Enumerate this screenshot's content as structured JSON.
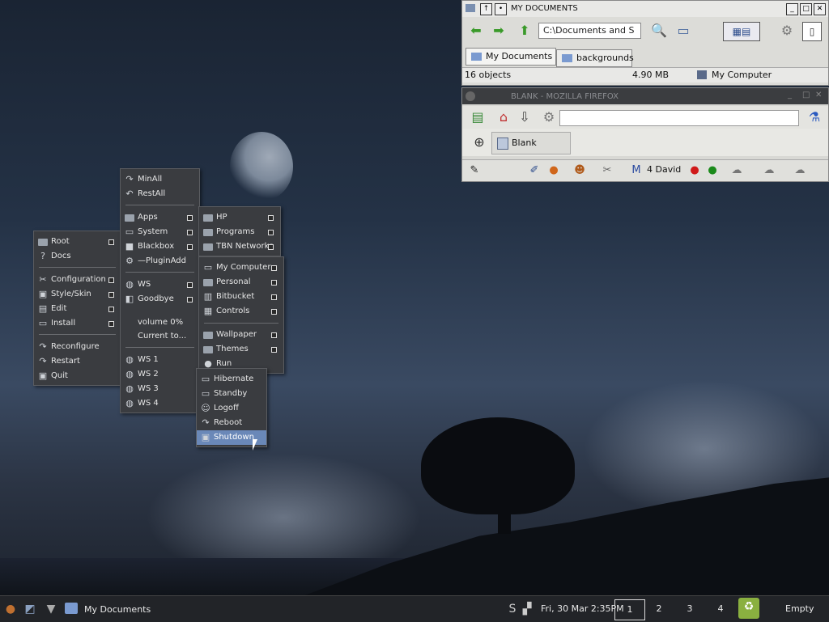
{
  "explorer": {
    "title": "MY DOCUMENTS",
    "path_value": "C:\\Documents and S",
    "tabs": [
      "My Documents",
      "backgrounds"
    ],
    "status": {
      "objects": "16 objects",
      "size": "4.90 MB",
      "location": "My Computer"
    }
  },
  "firefox": {
    "title": "BLANK - MOZILLA FIREFOX",
    "tab_label": "Blank",
    "statusbar_user": "4 David"
  },
  "menu_root": {
    "items": [
      {
        "label": "Root",
        "icon": "root-icon",
        "sub": true
      },
      {
        "label": "Docs",
        "icon": "help-icon",
        "sub": false
      },
      {
        "label": "Configuration",
        "icon": "tools-icon",
        "sub": true
      },
      {
        "label": "Style/Skin",
        "icon": "skin-icon",
        "sub": true
      },
      {
        "label": "Edit",
        "icon": "edit-icon",
        "sub": true
      },
      {
        "label": "Install",
        "icon": "install-icon",
        "sub": true
      },
      {
        "label": "Reconfigure",
        "icon": "arrow-icon",
        "sub": false
      },
      {
        "label": "Restart",
        "icon": "arrow-icon",
        "sub": false
      },
      {
        "label": "Quit",
        "icon": "quit-icon",
        "sub": false
      }
    ]
  },
  "menu_main": {
    "items": [
      {
        "label": "MinAll",
        "icon": "minall-icon",
        "sub": false
      },
      {
        "label": "RestAll",
        "icon": "restall-icon",
        "sub": false
      },
      {
        "label": "Apps",
        "icon": "folder-icon",
        "sub": true
      },
      {
        "label": "System",
        "icon": "system-icon",
        "sub": true
      },
      {
        "label": "Blackbox",
        "icon": "blackbox-icon",
        "sub": true
      },
      {
        "label": "—PluginAdd",
        "icon": "gear-icon",
        "sub": false
      },
      {
        "label": "WS",
        "icon": "ws-icon",
        "sub": true
      },
      {
        "label": "Goodbye",
        "icon": "goodbye-icon",
        "sub": true
      },
      {
        "label": "volume 0%",
        "icon": "",
        "sub": false
      },
      {
        "label": "Current to...",
        "icon": "",
        "sub": false
      },
      {
        "label": "WS 1",
        "icon": "ws-icon",
        "sub": false
      },
      {
        "label": "WS 2",
        "icon": "ws-icon",
        "sub": false
      },
      {
        "label": "WS 3",
        "icon": "ws-icon",
        "sub": false
      },
      {
        "label": "WS 4",
        "icon": "ws-icon",
        "sub": false
      }
    ]
  },
  "menu_apps": {
    "items": [
      {
        "label": "HP",
        "icon": "folder-icon",
        "sub": true
      },
      {
        "label": "Programs",
        "icon": "folder-icon",
        "sub": true
      },
      {
        "label": "TBN Networks",
        "icon": "folder-icon",
        "sub": true
      }
    ]
  },
  "menu_system": {
    "items": [
      {
        "label": "My Computer",
        "icon": "computer-icon",
        "sub": true
      },
      {
        "label": "Personal",
        "icon": "folder-icon",
        "sub": true
      },
      {
        "label": "Bitbucket",
        "icon": "bin-icon",
        "sub": true
      },
      {
        "label": "Controls",
        "icon": "controls-icon",
        "sub": true
      },
      {
        "label": "Wallpaper",
        "icon": "folder-icon",
        "sub": true
      },
      {
        "label": "Themes",
        "icon": "folder-icon",
        "sub": true
      },
      {
        "label": "Run",
        "icon": "run-icon",
        "sub": false
      }
    ]
  },
  "menu_goodbye": {
    "items": [
      {
        "label": "Hibernate",
        "icon": "hibernate-icon",
        "sub": false
      },
      {
        "label": "Standby",
        "icon": "standby-icon",
        "sub": false
      },
      {
        "label": "Logoff",
        "icon": "logoff-icon",
        "sub": false
      },
      {
        "label": "Reboot",
        "icon": "reboot-icon",
        "sub": false
      },
      {
        "label": "Shutdown",
        "icon": "shutdown-icon",
        "sub": false,
        "selected": true
      }
    ]
  },
  "taskbar": {
    "task_label": "My Documents",
    "datetime": "Fri, 30 Mar 2:35PM",
    "workspaces": [
      "1",
      "2",
      "3",
      "4"
    ],
    "active_workspace": "1",
    "recycle_label": "Empty"
  }
}
